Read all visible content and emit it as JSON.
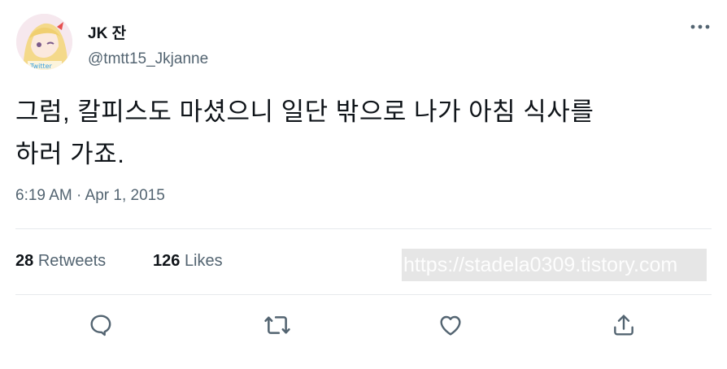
{
  "user": {
    "display_name": "JK 잔",
    "handle": "@tmtt15_Jkjanne"
  },
  "tweet": {
    "text_line1": "그럼, 칼피스도 마셨으니 일단 밖으로 나가 아침 식사를",
    "text_line2": "하러 가죠.",
    "timestamp": "6:19 AM · Apr 1, 2015"
  },
  "stats": {
    "retweets_count": "28",
    "retweets_label": "Retweets",
    "likes_count": "126",
    "likes_label": "Likes"
  },
  "watermark": "https://stadela0309.tistory.com",
  "actions": [
    "reply-icon",
    "retweet-icon",
    "like-icon",
    "share-icon"
  ],
  "colors": {
    "text": "#0f1419",
    "secondary": "#536471",
    "icon": "#536471",
    "divider": "#e6e9ec"
  }
}
